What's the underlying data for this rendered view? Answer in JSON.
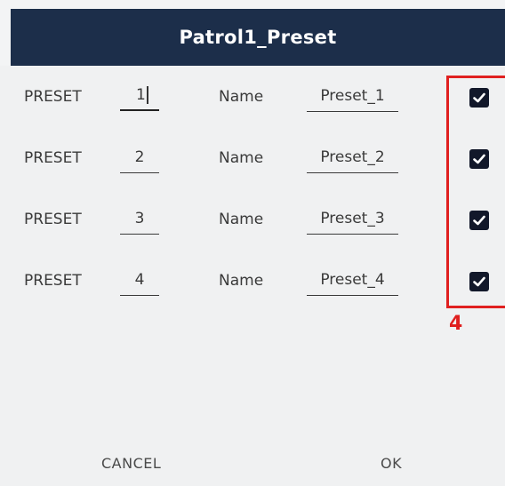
{
  "dialog": {
    "title": "Patrol1_Preset"
  },
  "rows": [
    {
      "preset_label": "PRESET",
      "number": "1",
      "name_label": "Name",
      "name": "Preset_1",
      "checked": true
    },
    {
      "preset_label": "PRESET",
      "number": "2",
      "name_label": "Name",
      "name": "Preset_2",
      "checked": true
    },
    {
      "preset_label": "PRESET",
      "number": "3",
      "name_label": "Name",
      "name": "Preset_3",
      "checked": true
    },
    {
      "preset_label": "PRESET",
      "number": "4",
      "name_label": "Name",
      "name": "Preset_4",
      "checked": true
    }
  ],
  "annotation": {
    "label": "4",
    "color": "#e02020"
  },
  "footer": {
    "cancel_label": "CANCEL",
    "ok_label": "OK"
  },
  "colors": {
    "title_bar": "#1c2e4a",
    "checkbox": "#12182a"
  },
  "icons": {
    "checkbox": "check-icon"
  }
}
